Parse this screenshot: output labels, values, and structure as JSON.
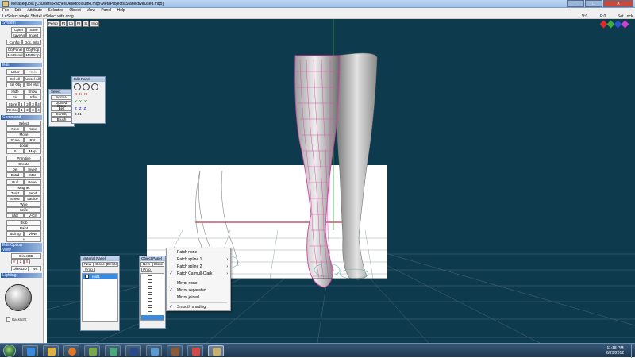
{
  "window": {
    "title": "Metasequoia [C:\\Users\\Rachel\\Desktop\\sumo.mqo\\MetaProjects\\StarlectiveUsed.mqo]"
  },
  "menu": [
    "File",
    "Edit",
    "Attribute",
    "Selected",
    "Object",
    "View",
    "Panel",
    "Help"
  ],
  "status": {
    "hint": "L=Select single Shift+L=Select with drag",
    "v": "V:0",
    "f": "F:0",
    "lock": "Set Lock"
  },
  "left_panel": {
    "system": {
      "title": "System",
      "buttons": [
        "Open",
        "Save",
        "SaveAs",
        "Insert",
        "Config",
        "Doc. Info",
        "ObjPanel",
        "ObjProp",
        "MatPanel",
        "MatProp"
      ]
    },
    "edit": {
      "title": "Edit",
      "undo": "Undo",
      "redo": "Redo",
      "sel_all": "Sel All",
      "unsel_all": "Unsel All",
      "sel_obj": "Sel Obj",
      "sel_mat": "Sel Mat",
      "hide": "Hide",
      "show": "Show",
      "fix": "Fix",
      "unfix": "Unfix",
      "store": "Store",
      "restore": "Restore",
      "nums": [
        "1",
        "2",
        "3",
        "4"
      ]
    },
    "command": {
      "title": "Command",
      "items": [
        "Select",
        "Rect",
        "Rope",
        "Move",
        "Scale",
        "Rot",
        "Local",
        "UV",
        "Map",
        "Primitive",
        "Create",
        "Del",
        "Invert",
        "Extrd",
        "Mat",
        "Pull",
        "Bevel",
        "Magnet",
        "Twist",
        "Bend",
        "Shear",
        "Lattice",
        "Wire",
        "Knife",
        "Mgt",
        "V-Clr",
        "Blob",
        "Paint",
        "BKimg",
        "View",
        "+"
      ]
    },
    "edit_option": {
      "title": "Edit Option"
    },
    "view": {
      "title": "View",
      "direct": "Direct3D",
      "axes": [
        "Y",
        "Z",
        "X"
      ],
      "mode": "Direct3D",
      "w": "Wn"
    },
    "lighting": {
      "title": "Lighting",
      "backlight": "Backlight"
    }
  },
  "viewport": {
    "tabs": [
      "Persp",
      "Pt",
      "Lo",
      "Fr",
      "Si",
      "Img"
    ],
    "icon_colors": [
      "#e02a2a",
      "#3ab03a",
      "#2a50d0",
      "#d040d0"
    ]
  },
  "select_panel": {
    "title": "Select",
    "items": [
      "Normal",
      "Joined faces",
      "Belt",
      "CurObj",
      "Brush"
    ]
  },
  "edit_panel": {
    "title": "Edit Panel",
    "rows": [
      "X",
      "Y",
      "Z"
    ],
    "value": "0.01"
  },
  "material_panel": {
    "title": "Material Panel",
    "buttons": [
      "New",
      "Clone",
      "Delete"
    ],
    "prop": "Prop",
    "row": "mat1"
  },
  "object_panel": {
    "title": "Object Panel",
    "buttons": [
      "New",
      "Clone"
    ],
    "prop": "Prop"
  },
  "context_menu": {
    "items": [
      "Patch none",
      "Patch spline 1",
      "Patch spline 2",
      "Patch Catmull-Clark",
      "Mirror none",
      "Mirror separated",
      "Mirror joined",
      "Smooth shading"
    ]
  },
  "taskbar": {
    "time": "11:18 PM",
    "date": "6/29/2012"
  }
}
